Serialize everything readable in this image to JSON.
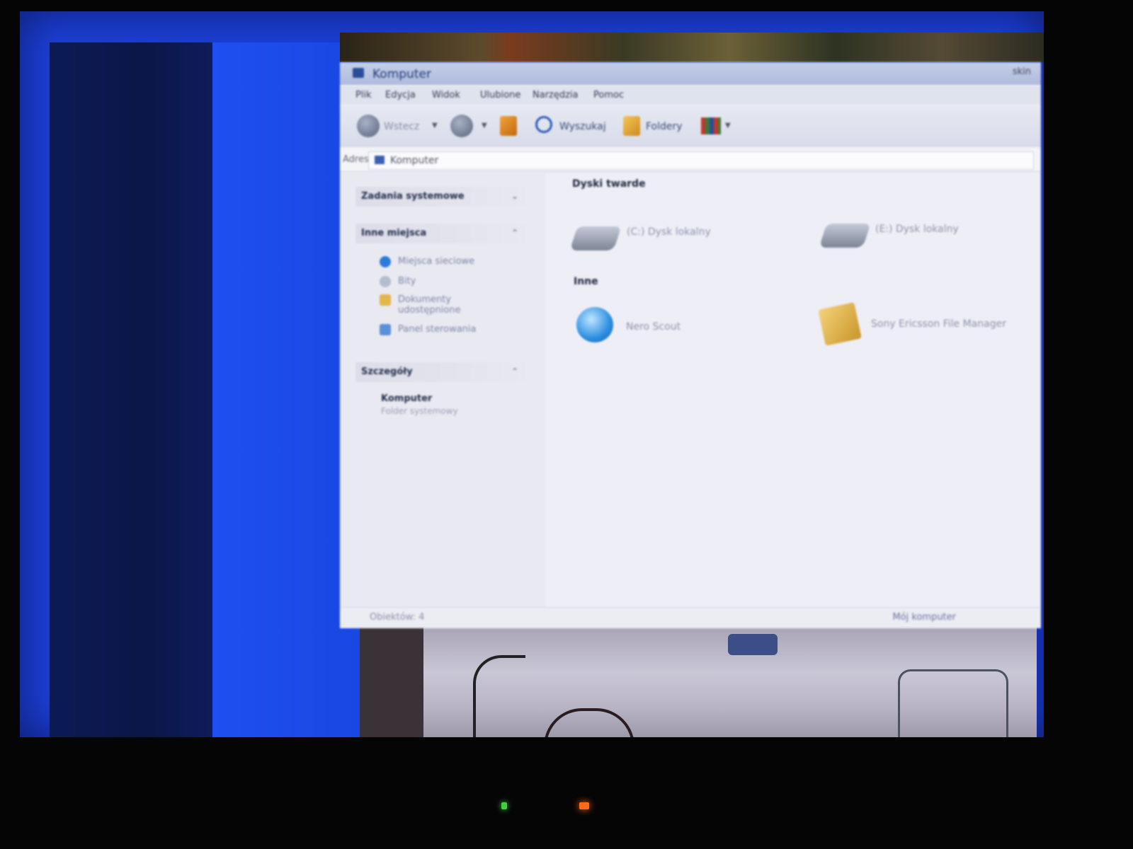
{
  "window": {
    "title": "Komputer",
    "title_right": "skin"
  },
  "menu": [
    "Plik",
    "Edycja",
    "Widok",
    "Ulubione",
    "Narzędzia",
    "Pomoc"
  ],
  "toolbar": {
    "back_label": "Wstecz",
    "search_label": "Wyszukaj",
    "folders_label": "Foldery"
  },
  "address": {
    "label": "Adres",
    "value": "Komputer"
  },
  "left_panel": {
    "system_tasks": "Zadania systemowe",
    "other_places": "Inne miejsca",
    "links": [
      "Miejsca sieciowe",
      "Bity",
      "Dokumenty udostępnione",
      "Panel sterowania"
    ],
    "details": "Szczegóły",
    "details_name": "Komputer",
    "details_desc": "Folder systemowy"
  },
  "content": {
    "hard_drives_title": "Dyski twarde",
    "drives": [
      "(C:) Dysk lokalny",
      "(E:) Dysk lokalny"
    ],
    "other_title": "Inne",
    "others": [
      "Nero Scout",
      "Sony Ericsson File Manager"
    ]
  },
  "status": {
    "objects": "Obiektów: 4",
    "location": "Mój komputer"
  },
  "icons": [
    "computer-icon",
    "back-icon",
    "forward-icon",
    "up-folder-icon",
    "search-icon",
    "folders-icon",
    "views-icon",
    "network-icon",
    "folder-icon",
    "control-panel-icon",
    "hard-drive-icon",
    "nero-scout-icon",
    "file-manager-icon"
  ],
  "colors": {
    "desktop_blue": "#1c3fd6",
    "window_bg": "#eeeef6",
    "led_green": "#3fd13a",
    "led_orange": "#ff6a1a"
  }
}
